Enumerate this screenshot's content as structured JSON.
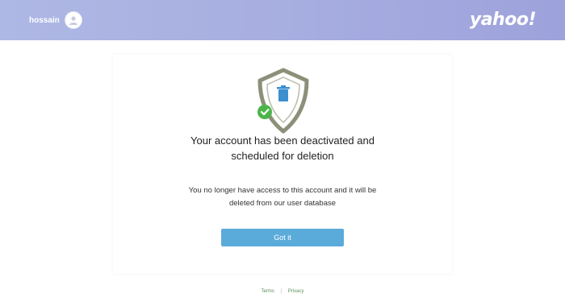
{
  "header": {
    "logo_text": "yahoo!",
    "username": "hossain"
  },
  "dialog": {
    "title": "Your account has been deactivated and scheduled for deletion",
    "description": "You no longer have access to this account and it will be deleted from our user database",
    "button_label": "Got it"
  },
  "footer": {
    "terms_label": "Terms",
    "privacy_label": "Privacy",
    "separator": "|"
  },
  "colors": {
    "header_gradient": [
      "#aeb8e4",
      "#9ea2dc"
    ],
    "button": "#5aabda",
    "shield_outline": "#8b9079",
    "check_badge": "#4cb54a",
    "trash_icon": "#3d8fd0"
  },
  "icons": {
    "shield": "shield-icon",
    "check": "check-icon",
    "trash": "trash-icon",
    "avatar": "user-avatar-icon"
  }
}
